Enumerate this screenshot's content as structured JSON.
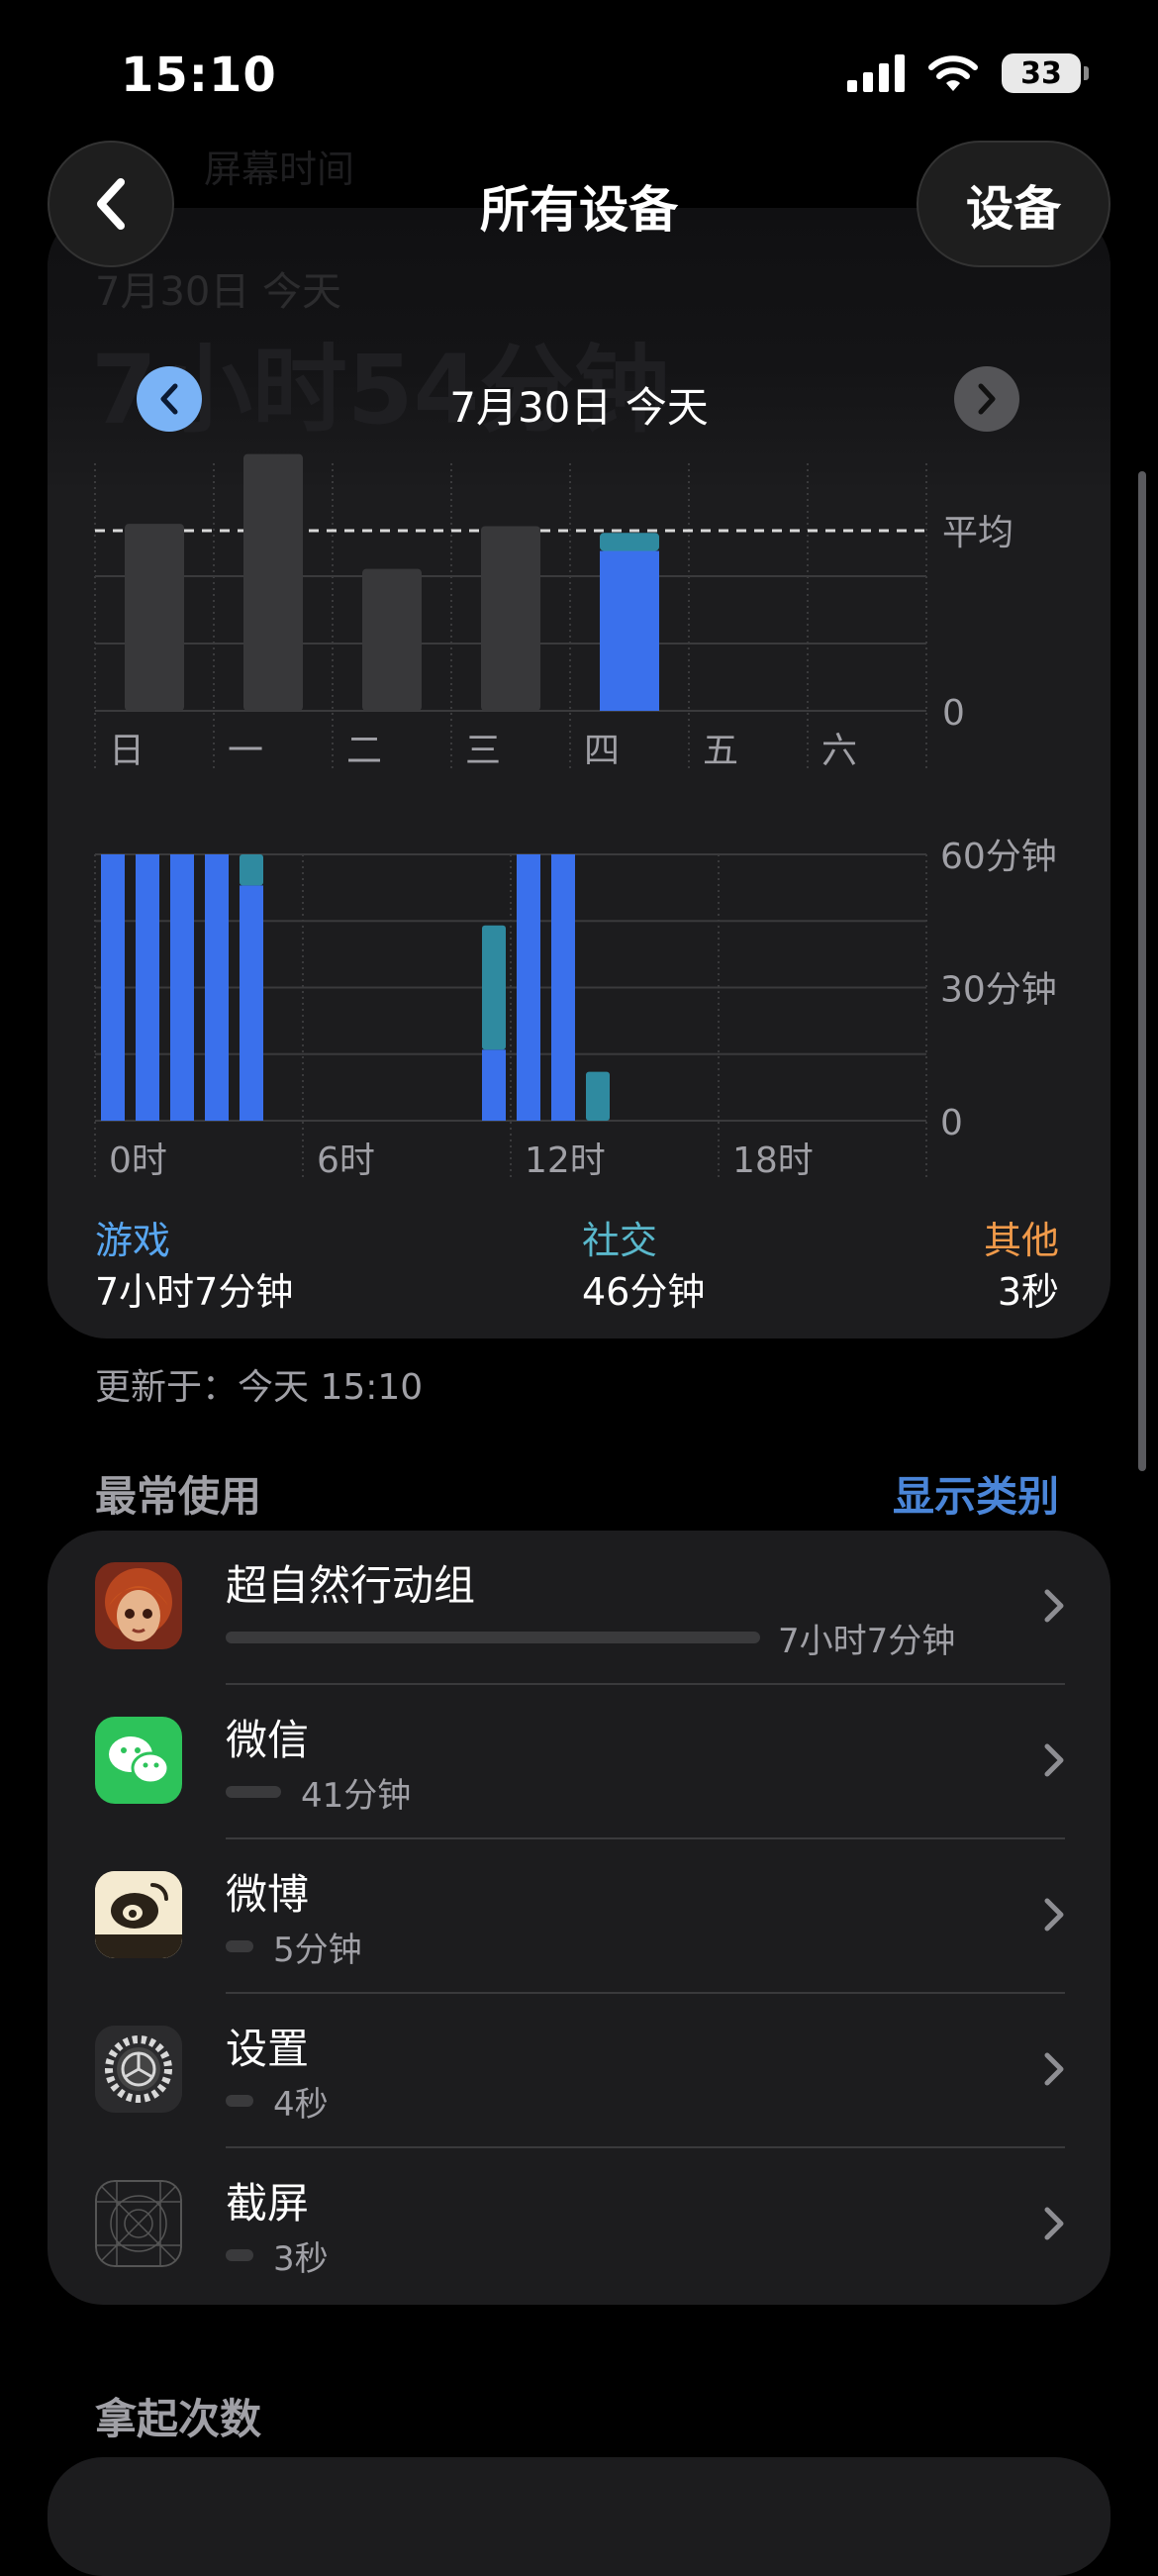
{
  "status": {
    "time": "15:10",
    "battery": "33"
  },
  "nav": {
    "title": "所有设备",
    "device_button": "设备"
  },
  "ghost": {
    "date": "7月30日 今天",
    "total": "7小时54分钟",
    "head": "屏幕时间"
  },
  "date_selector": {
    "label": "7月30日 今天"
  },
  "colors": {
    "games": "#3a70ec",
    "social": "#2f8aa0",
    "gray_bar": "#38383a",
    "accent": "#4a85d8",
    "other": "#f09a4a"
  },
  "chart_data": [
    {
      "type": "bar",
      "categories": [
        "日",
        "一",
        "二",
        "三",
        "四",
        "五",
        "六"
      ],
      "values": [
        8.3,
        11.4,
        6.3,
        8.2,
        7.9,
        null,
        null
      ],
      "series": [
        {
          "name": "游戏",
          "values": [
            null,
            null,
            null,
            null,
            7.1,
            null,
            null
          ]
        },
        {
          "name": "社交",
          "values": [
            null,
            null,
            null,
            null,
            0.8,
            null,
            null
          ]
        }
      ],
      "ytick_labels": {
        "avg": "平均",
        "zero": "0"
      },
      "average": 8.0,
      "ylim": [
        0,
        12
      ]
    },
    {
      "type": "bar",
      "hours": [
        0,
        1,
        2,
        3,
        4,
        11,
        12,
        13,
        14
      ],
      "series": [
        {
          "name": "游戏",
          "values": [
            60,
            60,
            60,
            60,
            53,
            16,
            60,
            60,
            0
          ]
        },
        {
          "name": "社交",
          "values": [
            0,
            0,
            0,
            0,
            7,
            28,
            0,
            0,
            11
          ]
        }
      ],
      "ytick_labels": [
        "60分钟",
        "30分钟",
        "0"
      ],
      "xtick_labels": [
        "0时",
        "6时",
        "12时",
        "18时"
      ],
      "ylim": [
        0,
        60
      ]
    }
  ],
  "legend": [
    {
      "name": "游戏",
      "value": "7小时7分钟",
      "color": "#58a6f0"
    },
    {
      "name": "社交",
      "value": "46分钟",
      "color": "#5ab8cc"
    },
    {
      "name": "其他",
      "value": "3秒",
      "color": "#f09a4a"
    }
  ],
  "updated": "更新于：今天 15:10",
  "most_used": {
    "title": "最常使用",
    "show_category": "显示类别"
  },
  "apps": [
    {
      "name": "超自然行动组",
      "duration": "7小时7分钟",
      "fraction": 1.0
    },
    {
      "name": "微信",
      "duration": "41分钟",
      "fraction": 0.1
    },
    {
      "name": "微博",
      "duration": "5分钟",
      "fraction": 0.05
    },
    {
      "name": "设置",
      "duration": "4秒",
      "fraction": 0.05
    },
    {
      "name": "截屏",
      "duration": "3秒",
      "fraction": 0.05
    }
  ],
  "pickups": {
    "title": "拿起次数"
  }
}
